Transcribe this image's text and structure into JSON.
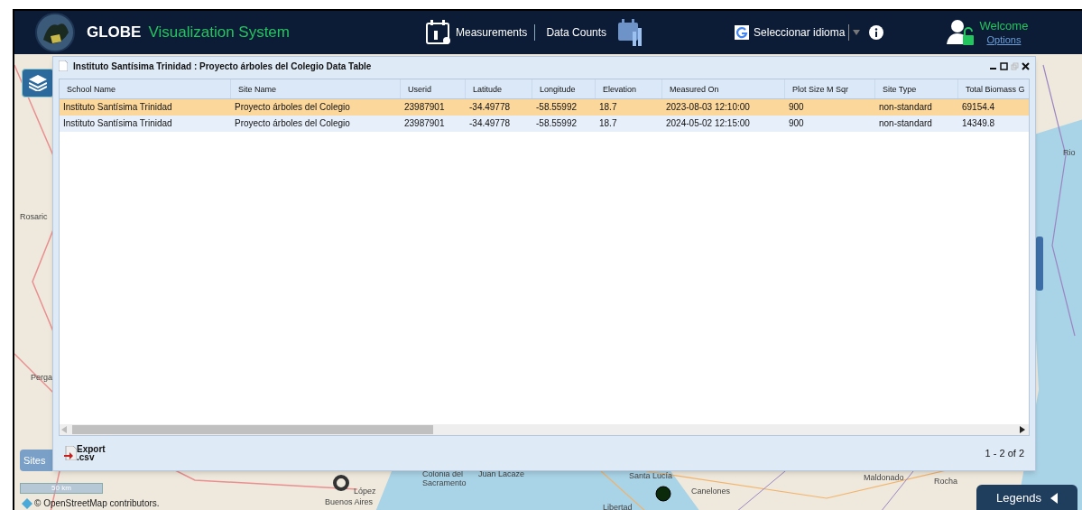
{
  "header": {
    "brand": "GLOBE",
    "subtitle": "Visualization System",
    "nav": [
      {
        "label": "Measurements"
      },
      {
        "label": "Data Counts"
      }
    ],
    "language": "Seleccionar idioma",
    "greeting": "Welcome",
    "options_link": "Options"
  },
  "dialog": {
    "title": "Instituto Santísima Trinidad : Proyecto árboles del Colegio Data Table",
    "columns": [
      "School Name",
      "Site Name",
      "Userid",
      "Latitude",
      "Longitude",
      "Elevation",
      "Measured On",
      "Plot Size M Sqr",
      "Site Type",
      "Total Biomass G"
    ],
    "rows": [
      {
        "selected": true,
        "cells": [
          "Instituto Santísima Trinidad",
          "Proyecto árboles del Colegio",
          "23987901",
          "-34.49778",
          "-58.55992",
          "18.7",
          "2023-08-03 12:10:00",
          "900",
          "non-standard",
          "69154.4"
        ]
      },
      {
        "selected": false,
        "cells": [
          "Instituto Santísima Trinidad",
          "Proyecto árboles del Colegio",
          "23987901",
          "-34.49778",
          "-58.55992",
          "18.7",
          "2024-05-02 12:15:00",
          "900",
          "non-standard",
          "14349.8"
        ]
      }
    ],
    "export_lines": [
      "Export",
      ".csv"
    ],
    "pager": "1 - 2 of 2"
  },
  "map": {
    "labels": [
      "Rosaric",
      "Perga",
      "Rio",
      "Colonia del",
      "Sacramento",
      "Juan Lacaze",
      "Santa Lucía",
      "Canelones",
      "Libertad",
      "Maldonado",
      "Rocha",
      "López",
      "Buenos Aires"
    ],
    "sites_tab": "Sites",
    "scale": "50 km",
    "attribution": "© OpenStreetMap contributors.",
    "legends": "Legends"
  }
}
